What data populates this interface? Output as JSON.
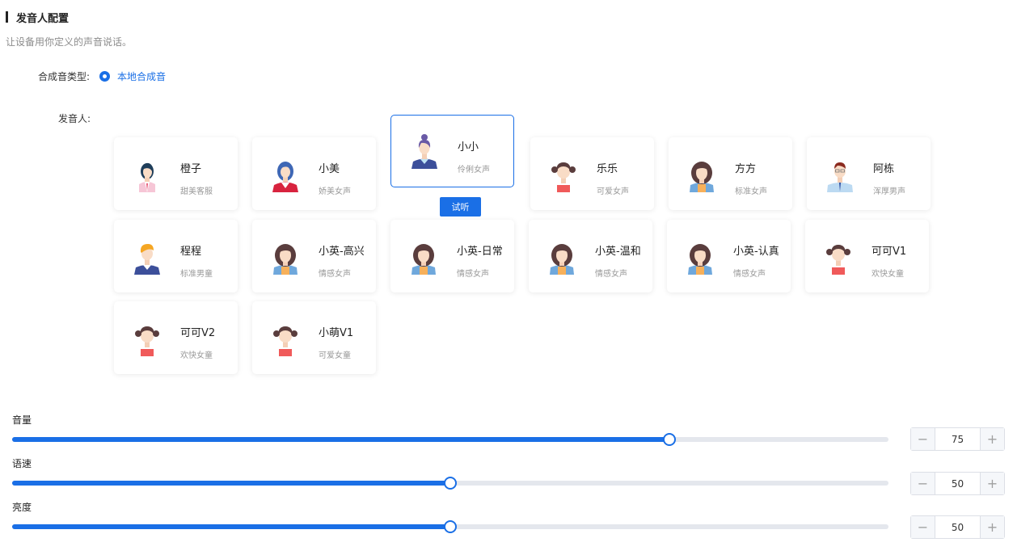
{
  "section": {
    "title": "发音人配置",
    "description": "让设备用你定义的声音说话。"
  },
  "synth": {
    "label": "合成音类型:",
    "option": "本地合成音"
  },
  "speaker_label": "发音人:",
  "speakers": [
    {
      "name": "橙子",
      "desc": "甜美客服",
      "avatar": "woman-service-avatar"
    },
    {
      "name": "小美",
      "desc": "娇美女声",
      "avatar": "woman-blue-hair-avatar"
    },
    {
      "name": "小小",
      "desc": "伶俐女声",
      "avatar": "woman-bun-avatar"
    },
    {
      "name": "乐乐",
      "desc": "可爱女声",
      "avatar": "girl-pigtails-avatar"
    },
    {
      "name": "方方",
      "desc": "标准女声",
      "avatar": "woman-long-hair-avatar"
    },
    {
      "name": "阿栋",
      "desc": "浑厚男声",
      "avatar": "man-glasses-avatar"
    },
    {
      "name": "程程",
      "desc": "标准男童",
      "avatar": "boy-avatar"
    },
    {
      "name": "小英-高兴",
      "desc": "情感女声",
      "avatar": "woman-long-hair-avatar"
    },
    {
      "name": "小英-日常",
      "desc": "情感女声",
      "avatar": "woman-long-hair-avatar"
    },
    {
      "name": "小英-温和",
      "desc": "情感女声",
      "avatar": "woman-long-hair-avatar"
    },
    {
      "name": "小英-认真",
      "desc": "情感女声",
      "avatar": "woman-long-hair-avatar"
    },
    {
      "name": "可可V1",
      "desc": "欢快女童",
      "avatar": "girl-pigtails-avatar"
    },
    {
      "name": "可可V2",
      "desc": "欢快女童",
      "avatar": "girl-pigtails-avatar"
    },
    {
      "name": "小萌V1",
      "desc": "可爱女童",
      "avatar": "girl-pigtails-avatar"
    }
  ],
  "selected_speaker": "小小",
  "try_button": "试听",
  "sliders": {
    "volume": {
      "label": "音量",
      "value": "75",
      "percent": 75
    },
    "speed": {
      "label": "语速",
      "value": "50",
      "percent": 50
    },
    "brightness": {
      "label": "亮度",
      "value": "50",
      "percent": 50
    }
  },
  "colors": {
    "accent": "#1a6fe6",
    "track": "#e4e7ed"
  },
  "icons": {
    "minus": "−",
    "plus": "+"
  }
}
